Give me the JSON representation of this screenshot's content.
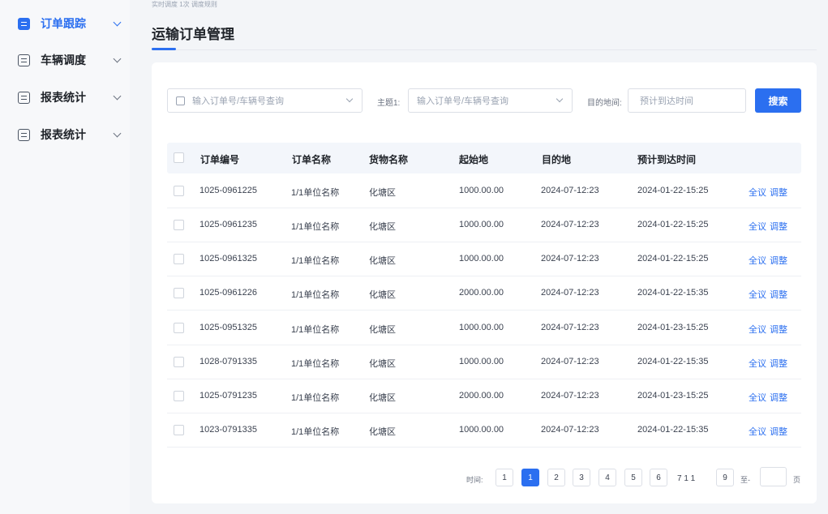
{
  "breadcrumb": "实时调度 1次 调度规则",
  "sidebar": {
    "items": [
      {
        "label": "订单跟踪",
        "icon": "order-icon"
      },
      {
        "label": "车辆调度",
        "icon": "vehicle-icon"
      },
      {
        "label": "报表统计",
        "icon": "report-icon"
      },
      {
        "label": "报表统计",
        "icon": "stats-icon"
      }
    ]
  },
  "page_title": "运输订单管理",
  "filters": {
    "order_placeholder": "输入订单号/车辆号查询",
    "owner_label": "主题1:",
    "owner_placeholder": "输入订单号/车辆号查询",
    "time_label": "目的地间:",
    "time_placeholder": "预计到达时间",
    "search_label": "搜索"
  },
  "table": {
    "headers": [
      "订单编号",
      "订单名称",
      "货物名称",
      "起始地",
      "目的地",
      "预计到达时间"
    ],
    "rows": [
      {
        "id": "1025-0961225",
        "name": "1/1单位名称",
        "goods": "化塘区",
        "origin": "1000.00.00",
        "dest": "2024-07-12:23",
        "eta": "2024-01-22-15:25"
      },
      {
        "id": "1025-0961235",
        "name": "1/1单位名称",
        "goods": "化塘区",
        "origin": "1000.00.00",
        "dest": "2024-07-12:23",
        "eta": "2024-01-22-15:25"
      },
      {
        "id": "1025-0961325",
        "name": "1/1单位名称",
        "goods": "化塘区",
        "origin": "1000.00.00",
        "dest": "2024-07-12:23",
        "eta": "2024-01-22-15:25"
      },
      {
        "id": "1025-0961226",
        "name": "1/1单位名称",
        "goods": "化塘区",
        "origin": "2000.00.00",
        "dest": "2024-07-12:23",
        "eta": "2024-01-22-15:35"
      },
      {
        "id": "1025-0951325",
        "name": "1/1单位名称",
        "goods": "化塘区",
        "origin": "1000.00.00",
        "dest": "2024-07-12:23",
        "eta": "2024-01-23-15:25"
      },
      {
        "id": "1028-0791335",
        "name": "1/1单位名称",
        "goods": "化塘区",
        "origin": "1000.00.00",
        "dest": "2024-07-12:23",
        "eta": "2024-01-22-15:35"
      },
      {
        "id": "1025-0791235",
        "name": "1/1单位名称",
        "goods": "化塘区",
        "origin": "2000.00.00",
        "dest": "2024-07-12:23",
        "eta": "2024-01-23-15:25"
      },
      {
        "id": "1023-0791335",
        "name": "1/1单位名称",
        "goods": "化塘区",
        "origin": "1000.00.00",
        "dest": "2024-07-12:23",
        "eta": "2024-01-22-15:35"
      }
    ],
    "action_view": "全议",
    "action_edit": "调整"
  },
  "pagination": {
    "label": "时间:",
    "pages": [
      "1",
      "1",
      "2",
      "3",
      "4",
      "5",
      "6"
    ],
    "ellipsis": "7 1 1",
    "last": "9",
    "goto_label": "至-",
    "suffix": "页",
    "active_index": 1
  },
  "colors": {
    "accent": "#2b6ff0"
  }
}
